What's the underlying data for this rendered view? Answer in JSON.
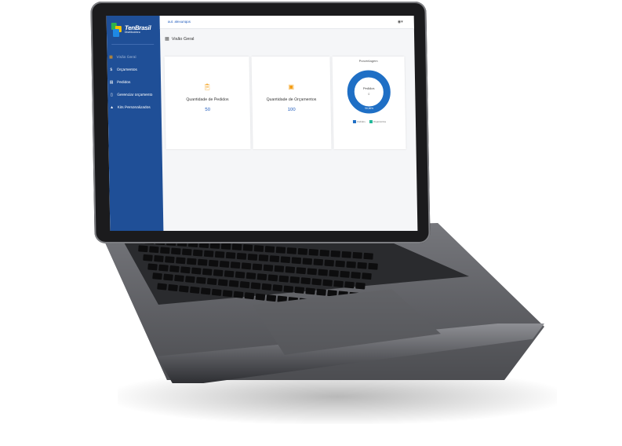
{
  "sidebar": {
    "logo": {
      "name": "TenBrasil",
      "subtitle": "Distribuidora"
    },
    "items": [
      {
        "label": "Visão Geral",
        "icon": "grid-icon",
        "active": true
      },
      {
        "label": "Orçamentos",
        "icon": "dollar-icon",
        "active": false
      },
      {
        "label": "Pedidos",
        "icon": "document-icon",
        "active": false
      },
      {
        "label": "Gerenciar orçamento",
        "icon": "file-icon",
        "active": false
      },
      {
        "label": "Kits Personalizados",
        "icon": "bag-icon",
        "active": false
      }
    ]
  },
  "topbar": {
    "breadcrumb": "out. alexunqos",
    "user_icon": "user-icon"
  },
  "page": {
    "title": "Visão Geral",
    "title_icon": "grid-icon"
  },
  "cards": [
    {
      "label": "Quantidade de Pedidos",
      "value": "50",
      "icon": "clipboard-icon"
    },
    {
      "label": "Quantidade de Orçamentos",
      "value": "100",
      "icon": "money-icon"
    }
  ],
  "donut_card": {
    "title": "Porcentagem",
    "center_label": "Pedidos",
    "center_value": "0",
    "bottom_label": "50,00%",
    "legend": [
      {
        "label": "Pedidos",
        "color": "#1f6fc5"
      },
      {
        "label": "Orçamentos",
        "color": "#23b89a"
      }
    ],
    "ring_color": "#1f6fc5"
  },
  "colors": {
    "sidebar": "#1f4f97",
    "accent": "#f39c12",
    "link": "#1f5bbd"
  }
}
